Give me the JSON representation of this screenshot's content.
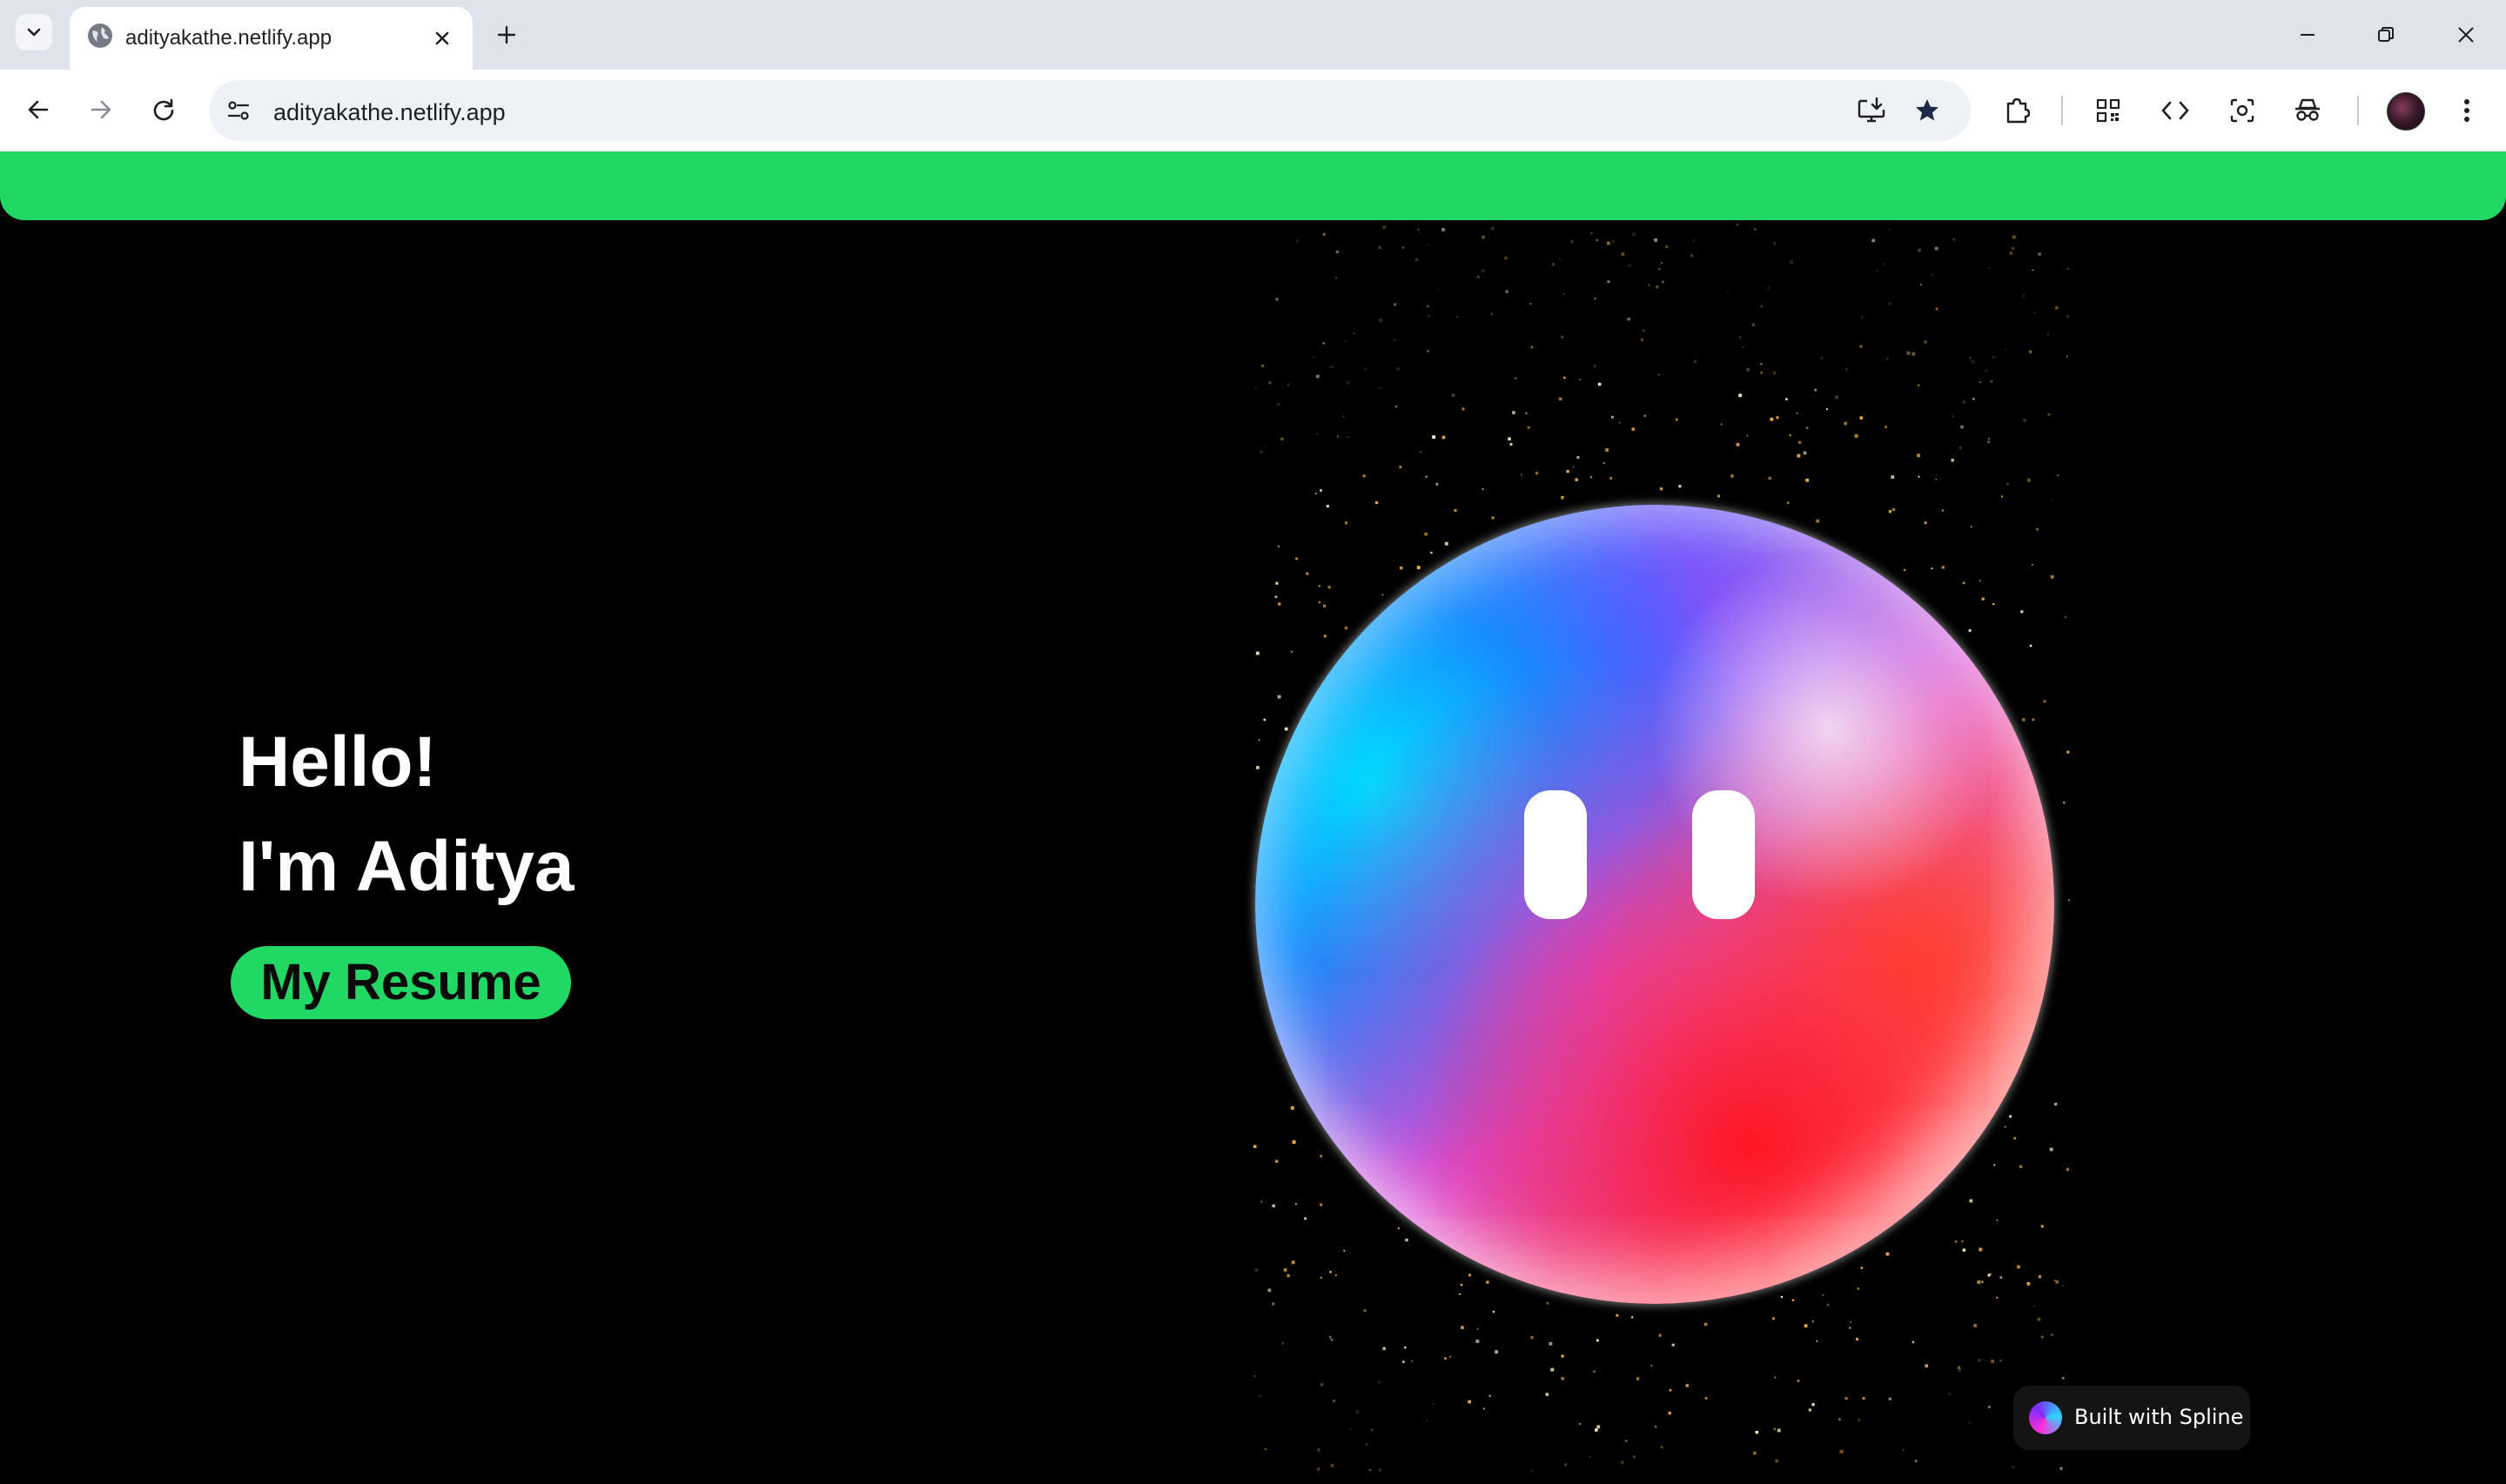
{
  "browser": {
    "tab": {
      "title": "adityakathe.netlify.app"
    },
    "omnibox": {
      "url": "adityakathe.netlify.app"
    },
    "icons": [
      "tab-search-icon",
      "globe-favicon-icon",
      "close-icon",
      "plus-icon",
      "minimize-icon",
      "restore-icon",
      "window-close-icon",
      "back-icon",
      "forward-icon",
      "reload-icon",
      "site-info-icon",
      "install-app-icon",
      "bookmark-star-icon",
      "extensions-icon",
      "qr-code-icon",
      "devtools-icon",
      "screenshot-icon",
      "incognito-icon",
      "kebab-menu-icon"
    ]
  },
  "page": {
    "navbar_color": "#21d865",
    "hero": {
      "line1": "Hello!",
      "line2": "I'm Aditya",
      "resume_button": "My Resume"
    },
    "spline_badge": {
      "label": "Built with Spline"
    }
  },
  "colors": {
    "accent": "#21d865",
    "background": "#000000"
  }
}
